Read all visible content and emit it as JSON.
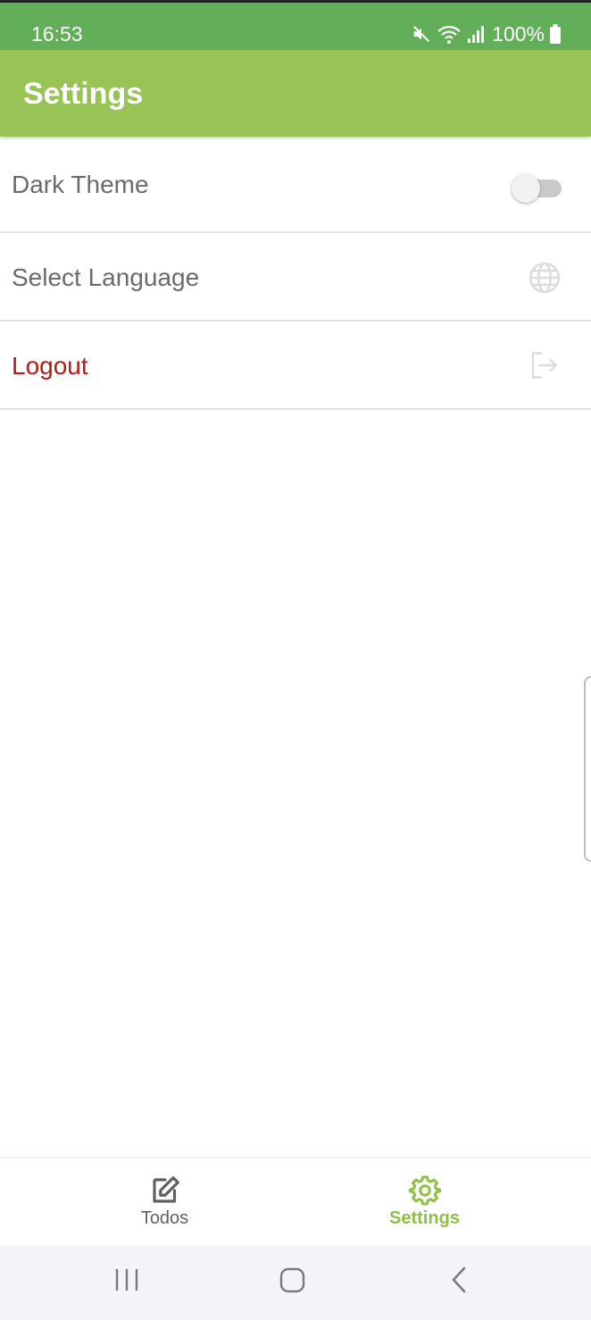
{
  "status_bar": {
    "time": "16:53",
    "battery_percent": "100%",
    "icons": [
      "mute-icon",
      "wifi-icon",
      "signal-icon",
      "battery-icon"
    ]
  },
  "header": {
    "title": "Settings"
  },
  "settings": {
    "dark_theme": {
      "label": "Dark Theme",
      "enabled": false
    },
    "language": {
      "label": "Select Language",
      "icon": "globe-icon"
    },
    "logout": {
      "label": "Logout",
      "icon": "logout-icon",
      "color": "#b71b13"
    }
  },
  "tabs": [
    {
      "label": "Todos",
      "icon": "edit-icon",
      "active": false
    },
    {
      "label": "Settings",
      "icon": "gear-icon",
      "active": true
    }
  ],
  "colors": {
    "status_bar": "#62ae59",
    "app_bar": "#98c355",
    "active_tab": "#8fc046",
    "danger": "#b71b13"
  },
  "system_nav": [
    "recents-icon",
    "home-icon",
    "back-icon"
  ]
}
